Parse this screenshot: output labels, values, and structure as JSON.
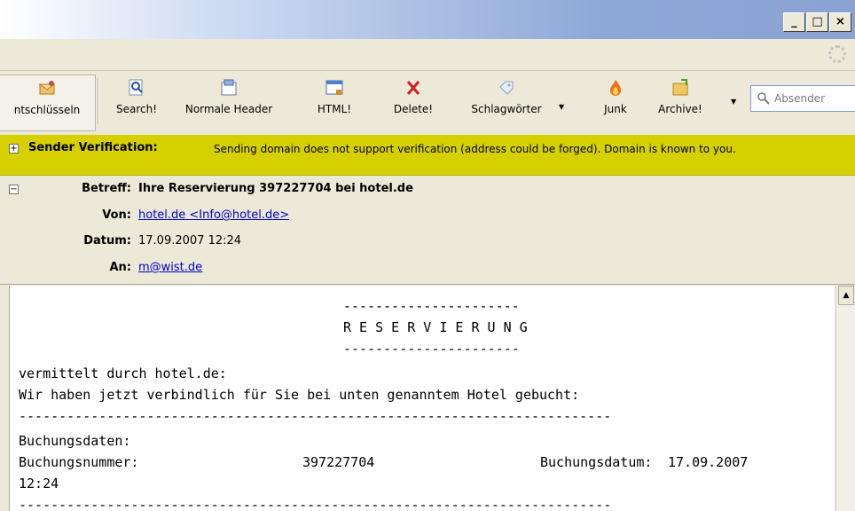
{
  "window": {
    "controls": {
      "minimize": "_",
      "maximize": "□",
      "close": "×"
    }
  },
  "toolbar": {
    "buttons": [
      {
        "label": "ntschlüsseln",
        "icon": "decrypt-icon"
      },
      {
        "label": "Search!",
        "icon": "search-icon"
      },
      {
        "label": "Normale Header",
        "icon": "headers-icon"
      },
      {
        "label": "HTML!",
        "icon": "html-icon"
      },
      {
        "label": "Delete!",
        "icon": "delete-icon"
      },
      {
        "label": "Schlagwörter",
        "icon": "tag-icon"
      },
      {
        "label": "Junk",
        "icon": "junk-icon"
      },
      {
        "label": "Archive!",
        "icon": "archive-icon"
      }
    ],
    "search_placeholder": "Absender"
  },
  "verification": {
    "label": "Sender Verification:",
    "message": "Sending domain does not support verification (address could be forged). Domain is known to you."
  },
  "headers": {
    "subject_label": "Betreff:",
    "subject": "Ihre Reservierung 397227704 bei hotel.de",
    "from_label": "Von:",
    "from": "hotel.de <Info@hotel.de>",
    "date_label": "Datum:",
    "date": "17.09.2007 12:24",
    "to_label": "An:",
    "to": "m@wist.de"
  },
  "message_body": {
    "rule_short": "----------------------",
    "heading": "R E S E R V I E R U N G",
    "line1": "vermittelt durch hotel.de:",
    "line2": "Wir haben jetzt verbindlich für Sie bei unten genanntem Hotel gebucht:",
    "rule_long": "--------------------------------------------------------------------------",
    "section": "Buchungsdaten:",
    "booking_no_label": "Buchungsnummer:",
    "booking_no": "397227704",
    "booking_date_label": "Buchungsdatum:",
    "booking_date": "17.09.2007",
    "booking_time": "12:24"
  },
  "colors": {
    "verification_bg": "#d7d000",
    "link": "#0000cc",
    "chrome": "#ece9d8"
  }
}
